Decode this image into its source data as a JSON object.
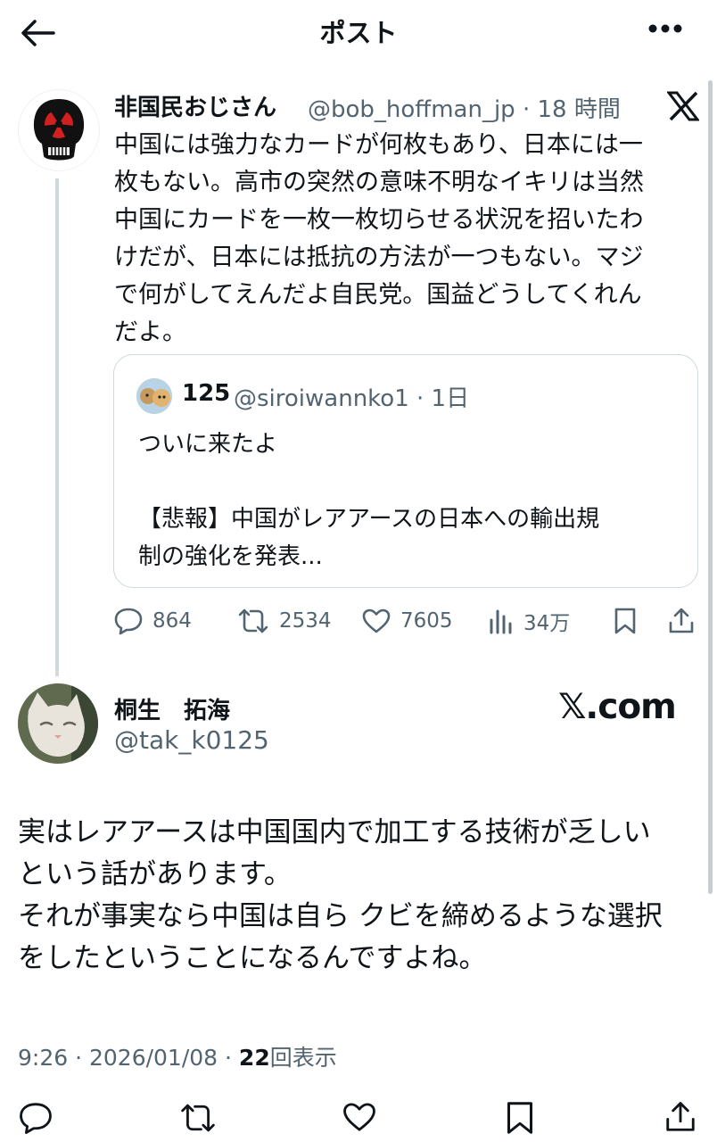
{
  "header": {
    "title": "ポスト",
    "back_icon": "arrow-left-icon",
    "more_icon": "more-horizontal-icon"
  },
  "post": {
    "author_name": "非国民おじさん",
    "handle_time": "@bob_hoffman_jp · 18 時間",
    "body": "中国には強力なカードが何枚もあり、日本には一\n枚もない。高市の突然の意味不明なイキリは当然\n中国にカードを一枚一枚切らせる状況を招いたわ\nけだが、日本には抵抗の方法が一つもない。マジ\nで何がしてえんだよ自民党。国益どうしてくれん\nだよ。",
    "quote": {
      "author_name": "125",
      "handle_time": "@siroiwannko1 · 1日",
      "body": "ついに来たよ\n\n【悲報】中国がレアアースの日本への輸出規\n制の強化を発表..."
    },
    "actions": {
      "replies": "864",
      "reposts": "2534",
      "likes": "7605",
      "views": "34万"
    }
  },
  "reply": {
    "author_name": "桐生　拓海",
    "handle": "@tak_k0125",
    "brand": "𝕏.com",
    "body": "実はレアアースは中国国内で加工する技術が乏しい\nという話があります。\nそれが事実なら中国は自ら クビを締めるような選択\nをしたということになるんですよね。",
    "timestamp": "9:26 · 2026/01/08 · ",
    "view_count": "22",
    "view_label": "回表示"
  },
  "colors": {
    "text": "#0f1419",
    "secondary": "#536471",
    "border": "#cfd9de"
  }
}
